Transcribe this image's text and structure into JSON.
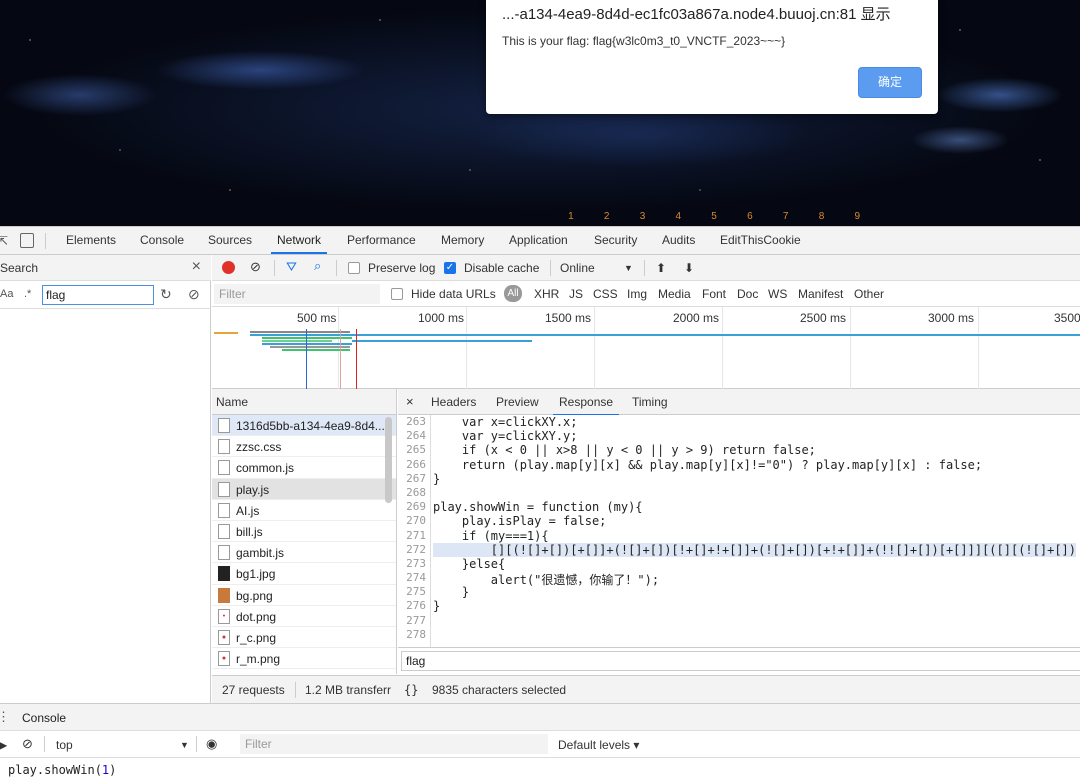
{
  "dialog": {
    "title": "...-a134-4ea9-8d4d-ec1fc03a867a.node4.buuoj.cn:81 显示",
    "message": "This is your flag: flag{w3lc0m3_t0_VNCTF_2023~~~}",
    "ok_label": "确定"
  },
  "game": {
    "numbers": [
      "1",
      "2",
      "3",
      "4",
      "5",
      "6",
      "7",
      "8",
      "9"
    ]
  },
  "devtools": {
    "tabs": [
      "Elements",
      "Console",
      "Sources",
      "Network",
      "Performance",
      "Memory",
      "Application",
      "Security",
      "Audits",
      "EditThisCookie"
    ],
    "active_tab": "Network"
  },
  "search": {
    "title": "Search",
    "case_option": "Aa",
    "regex_option": ".*",
    "query": "flag"
  },
  "network": {
    "preserve_log": "Preserve log",
    "disable_cache": "Disable cache",
    "throttle": "Online",
    "filter_placeholder": "Filter",
    "hide_data_urls": "Hide data URLs",
    "all": "All",
    "types": [
      "XHR",
      "JS",
      "CSS",
      "Img",
      "Media",
      "Font",
      "Doc",
      "WS",
      "Manifest",
      "Other"
    ],
    "timeline_labels": [
      "500 ms",
      "1000 ms",
      "1500 ms",
      "2000 ms",
      "2500 ms",
      "3000 ms",
      "3500"
    ],
    "name_header": "Name",
    "requests": [
      {
        "name": "1316d5bb-a134-4ea9-8d4..."
      },
      {
        "name": "zzsc.css"
      },
      {
        "name": "common.js"
      },
      {
        "name": "play.js"
      },
      {
        "name": "AI.js"
      },
      {
        "name": "bill.js"
      },
      {
        "name": "gambit.js"
      },
      {
        "name": "bg1.jpg"
      },
      {
        "name": "bg.png"
      },
      {
        "name": "dot.png"
      },
      {
        "name": "r_c.png"
      },
      {
        "name": "r_m.png"
      }
    ],
    "detail_tabs": [
      "Headers",
      "Preview",
      "Response",
      "Timing"
    ],
    "active_detail_tab": "Response",
    "find_value": "flag",
    "status_requests": "27 requests",
    "status_transfer": "1.2 MB transferr",
    "status_selected": "9835 characters selected"
  },
  "code": [
    {
      "ln": "263",
      "src": "    var x=clickXY.x;"
    },
    {
      "ln": "264",
      "src": "    var y=clickXY.y;"
    },
    {
      "ln": "265",
      "src": "    if (x < 0 || x>8 || y < 0 || y > 9) return false;"
    },
    {
      "ln": "266",
      "src": "    return (play.map[y][x] && play.map[y][x]!=\"0\") ? play.map[y][x] : false;"
    },
    {
      "ln": "267",
      "src": "}"
    },
    {
      "ln": "268",
      "src": ""
    },
    {
      "ln": "269",
      "src": "play.showWin = function (my){"
    },
    {
      "ln": "270",
      "src": "    play.isPlay = false;"
    },
    {
      "ln": "271",
      "src": "    if (my===1){"
    },
    {
      "ln": "272",
      "src": "        [][(![]+[])[+[]]+(![]+[])[!+[]+!+[]]+(![]+[])[+!+[]]+(!![]+[])[+[]]][([][(![]+[])"
    },
    {
      "ln": "273",
      "src": "    }else{"
    },
    {
      "ln": "274",
      "src": "        alert(\"很遗憾，你输了！\");"
    },
    {
      "ln": "275",
      "src": "    }"
    },
    {
      "ln": "276",
      "src": "}"
    },
    {
      "ln": "277",
      "src": ""
    },
    {
      "ln": "278",
      "src": ""
    }
  ],
  "console": {
    "tab_label": "Console",
    "context": "top",
    "filter_placeholder": "Filter",
    "levels": "Default levels ▾",
    "input_prefix": "play.showWin(",
    "input_arg": "1",
    "input_suffix": ")"
  }
}
